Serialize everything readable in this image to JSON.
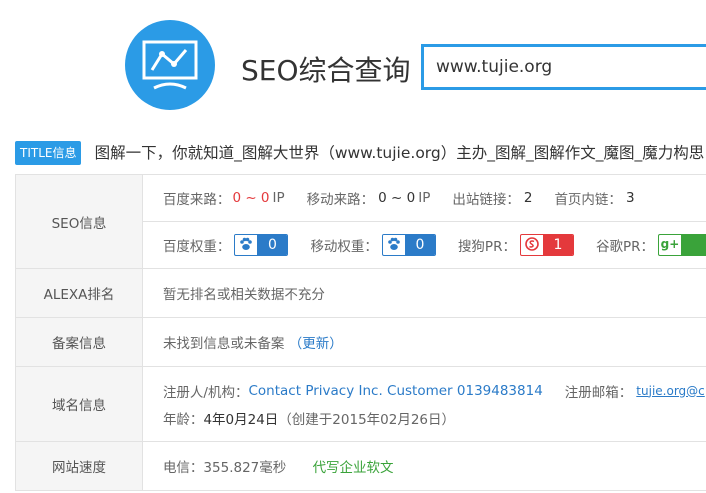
{
  "header": {
    "title": "SEO综合查询",
    "search_value": "www.tujie.org"
  },
  "title_info": {
    "badge": "TITLE信息",
    "text": "图解一下，你就知道_图解大世界（www.tujie.org）主办_图解_图解作文_魔图_魔力构思"
  },
  "seo": {
    "label": "SEO信息",
    "baidu_source_label": "百度来路：",
    "baidu_source_value": "0 ~ 0",
    "baidu_source_unit": "IP",
    "mobile_source_label": "移动来路：",
    "mobile_source_value": "0 ~ 0",
    "mobile_source_unit": "IP",
    "outbound_label": "出站链接：",
    "outbound_value": "2",
    "inbound_label": "首页内链：",
    "inbound_value": "3",
    "baidu_weight_label": "百度权重：",
    "baidu_weight_value": "0",
    "mobile_weight_label": "移动权重：",
    "mobile_weight_value": "0",
    "sogou_pr_label": "搜狗PR：",
    "sogou_pr_value": "1",
    "google_pr_label": "谷歌PR："
  },
  "alexa": {
    "label": "ALEXA排名",
    "text": "暂无排名或相关数据不充分"
  },
  "icp": {
    "label": "备案信息",
    "text": "未找到信息或未备案",
    "update_link": "（更新）"
  },
  "domain": {
    "label": "域名信息",
    "registrant_label": "注册人/机构：",
    "registrant_value": "Contact Privacy Inc. Customer 0139483814",
    "email_label": "注册邮箱：",
    "email_value": "tujie.org@c",
    "age_label": "年龄：",
    "age_value": "4年0月24日",
    "created_text": "（创建于2015年02月26日）"
  },
  "speed": {
    "label": "网站速度",
    "telecom_text": "电信：355.827毫秒",
    "ad_link": "代写企业软文"
  },
  "colors": {
    "accent": "#2b9be6",
    "red": "#e4393c",
    "green": "#3aa33a",
    "link": "#2b7bc8"
  }
}
